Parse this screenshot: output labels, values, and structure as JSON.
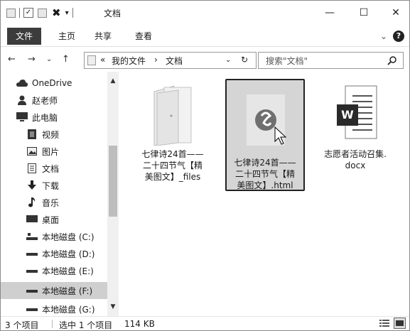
{
  "window": {
    "title": "文档",
    "minimize": "—",
    "maximize": "☐",
    "close": "✕"
  },
  "ribbon": {
    "tabs": [
      "文件",
      "主页",
      "共享",
      "查看"
    ],
    "expand": "⌄",
    "help": "?"
  },
  "address": {
    "back": "←",
    "forward": "→",
    "recent": "⌄",
    "up": "↑",
    "overflow": "«",
    "crumbs": [
      "我的文件",
      "文档"
    ],
    "separator": "›",
    "dropdown": "⌄",
    "refresh": "↻"
  },
  "search": {
    "placeholder": "搜索\"文档\"",
    "icon": "search-icon"
  },
  "navpane": {
    "items": [
      {
        "label": "OneDrive",
        "icon": "cloud-icon"
      },
      {
        "label": "赵老师",
        "icon": "user-icon"
      },
      {
        "label": "此电脑",
        "icon": "computer-icon"
      },
      {
        "label": "视频",
        "icon": "video-icon"
      },
      {
        "label": "图片",
        "icon": "pictures-icon"
      },
      {
        "label": "文档",
        "icon": "document-icon"
      },
      {
        "label": "下载",
        "icon": "download-icon"
      },
      {
        "label": "音乐",
        "icon": "music-icon"
      },
      {
        "label": "桌面",
        "icon": "desktop-icon"
      },
      {
        "label": "本地磁盘 (C:)",
        "icon": "system-drive-icon"
      },
      {
        "label": "本地磁盘 (D:)",
        "icon": "drive-icon"
      },
      {
        "label": "本地磁盘 (E:)",
        "icon": "drive-icon"
      },
      {
        "label": "本地磁盘 (F:)",
        "icon": "drive-icon",
        "selected": true
      },
      {
        "label": "本地磁盘 (G:)",
        "icon": "drive-icon"
      }
    ]
  },
  "files": [
    {
      "name": "七律诗24首——二十四节气【精美图文】_files",
      "lines": [
        "七律诗24首——",
        "二十四节气【精",
        "美图文】_files"
      ],
      "type": "folder"
    },
    {
      "name": "七律诗24首——二十四节气【精美图文】.html",
      "lines": [
        "七律诗24首——",
        "二十四节气【精",
        "美图文】.html"
      ],
      "type": "html",
      "selected": true
    },
    {
      "name": "志愿者活动召集.docx",
      "lines": [
        "志愿者活动召集.",
        "docx"
      ],
      "type": "word"
    }
  ],
  "word_icon_letter": "W",
  "status": {
    "count": "3 个项目",
    "selected": "选中 1 个项目",
    "size": "114 KB"
  }
}
